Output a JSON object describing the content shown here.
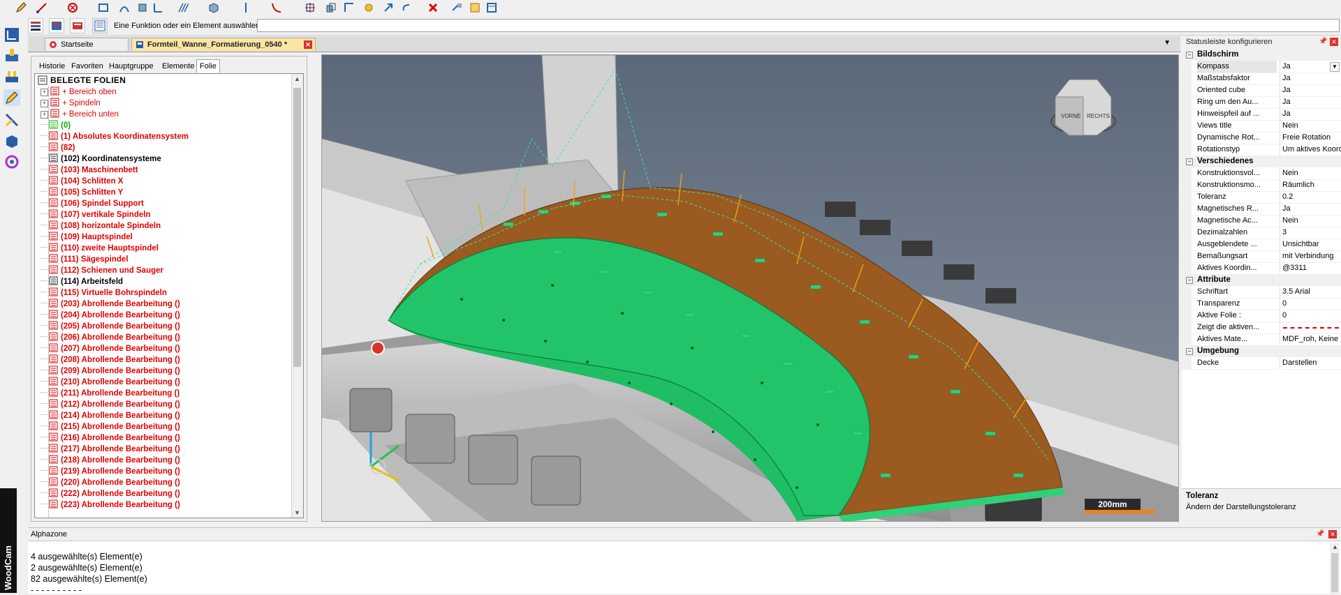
{
  "toolbar": {
    "command_label": "Eine Funktion oder ein Element auswählen:",
    "command_value": ""
  },
  "brand": "WoodCam",
  "doc_tabs": [
    {
      "label": "Startseite"
    },
    {
      "label": "Formteil_Wanne_Formatierung_0540 *"
    }
  ],
  "tree": {
    "tabs": [
      "Historie",
      "Favoriten",
      "Hauptgruppe",
      "Elemente",
      "Folie"
    ],
    "active_tab": "Folie",
    "header": "BELEGTE FOLIEN",
    "items": [
      {
        "label": "+ Bereich oben",
        "style": "red-light",
        "expandable": true
      },
      {
        "label": "+ Spindeln",
        "style": "red-light",
        "expandable": true
      },
      {
        "label": "+ Bereich unten",
        "style": "red-light",
        "expandable": true
      },
      {
        "label": "(0)",
        "style": "green",
        "expandable": false
      },
      {
        "label": "(1) Absolutes Koordinatensystem",
        "style": "red",
        "expandable": false
      },
      {
        "label": "(82)",
        "style": "red",
        "expandable": false
      },
      {
        "label": "(102) Koordinatensysteme",
        "style": "black",
        "expandable": false
      },
      {
        "label": "(103) Maschinenbett",
        "style": "red",
        "expandable": false
      },
      {
        "label": "(104) Schlitten X",
        "style": "red",
        "expandable": false
      },
      {
        "label": "(105) Schlitten Y",
        "style": "red",
        "expandable": false
      },
      {
        "label": "(106) Spindel Support",
        "style": "red",
        "expandable": false
      },
      {
        "label": "(107) vertikale Spindeln",
        "style": "red",
        "expandable": false
      },
      {
        "label": "(108) horizontale Spindeln",
        "style": "red",
        "expandable": false
      },
      {
        "label": "(109) Hauptspindel",
        "style": "red",
        "expandable": false
      },
      {
        "label": "(110) zweite Hauptspindel",
        "style": "red",
        "expandable": false
      },
      {
        "label": "(111) Sägespindel",
        "style": "red",
        "expandable": false
      },
      {
        "label": "(112) Schienen und Sauger",
        "style": "red",
        "expandable": false
      },
      {
        "label": "(114) Arbeitsfeld",
        "style": "black",
        "expandable": false
      },
      {
        "label": "(115) Virtuelle Bohrspindeln",
        "style": "red",
        "expandable": false
      },
      {
        "label": "(203) Abrollende Bearbeitung ()",
        "style": "red",
        "expandable": false
      },
      {
        "label": "(204) Abrollende Bearbeitung ()",
        "style": "red",
        "expandable": false
      },
      {
        "label": "(205) Abrollende Bearbeitung ()",
        "style": "red",
        "expandable": false
      },
      {
        "label": "(206) Abrollende Bearbeitung ()",
        "style": "red",
        "expandable": false
      },
      {
        "label": "(207) Abrollende Bearbeitung ()",
        "style": "red",
        "expandable": false
      },
      {
        "label": "(208) Abrollende Bearbeitung ()",
        "style": "red",
        "expandable": false
      },
      {
        "label": "(209) Abrollende Bearbeitung ()",
        "style": "red",
        "expandable": false
      },
      {
        "label": "(210) Abrollende Bearbeitung ()",
        "style": "red",
        "expandable": false
      },
      {
        "label": "(211) Abrollende Bearbeitung ()",
        "style": "red",
        "expandable": false
      },
      {
        "label": "(212) Abrollende Bearbeitung ()",
        "style": "red",
        "expandable": false
      },
      {
        "label": "(214) Abrollende Bearbeitung ()",
        "style": "red",
        "expandable": false
      },
      {
        "label": "(215) Abrollende Bearbeitung ()",
        "style": "red",
        "expandable": false
      },
      {
        "label": "(216) Abrollende Bearbeitung ()",
        "style": "red",
        "expandable": false
      },
      {
        "label": "(217) Abrollende Bearbeitung ()",
        "style": "red",
        "expandable": false
      },
      {
        "label": "(218) Abrollende Bearbeitung ()",
        "style": "red",
        "expandable": false
      },
      {
        "label": "(219) Abrollende Bearbeitung ()",
        "style": "red",
        "expandable": false
      },
      {
        "label": "(220) Abrollende Bearbeitung ()",
        "style": "red",
        "expandable": false
      },
      {
        "label": "(222) Abrollende Bearbeitung ()",
        "style": "red",
        "expandable": false
      },
      {
        "label": "(223) Abrollende Bearbeitung ()",
        "style": "red",
        "expandable": false
      }
    ]
  },
  "viewport": {
    "cube_labels": [
      "VORNE",
      "RECHTS"
    ],
    "scale_label": "200mm"
  },
  "properties": {
    "title": "Statusleiste konfigurieren",
    "categories": [
      {
        "name": "Bildschirm",
        "rows": [
          {
            "key": "Kompass",
            "value": "Ja",
            "selected": true
          },
          {
            "key": "Maßstabsfaktor",
            "value": "Ja"
          },
          {
            "key": "Oriented cube",
            "value": "Ja"
          },
          {
            "key": "Ring um den Au...",
            "value": "Ja"
          },
          {
            "key": "Hinweispfeil auf ...",
            "value": "Ja"
          },
          {
            "key": "Views title",
            "value": "Nein"
          },
          {
            "key": "Dynamische Rot...",
            "value": "Freie Rotation"
          },
          {
            "key": "Rotationstyp",
            "value": "Um aktives Koordin..."
          }
        ]
      },
      {
        "name": "Verschiedenes",
        "rows": [
          {
            "key": "Konstruktionsvol...",
            "value": "Nein"
          },
          {
            "key": "Konstruktionsmo...",
            "value": "Räumlich"
          },
          {
            "key": "Toleranz",
            "value": "0.2"
          },
          {
            "key": "Magnetisches R...",
            "value": "Ja"
          },
          {
            "key": "Magnetische Ac...",
            "value": "Nein"
          },
          {
            "key": "Dezimalzahlen",
            "value": "3"
          },
          {
            "key": "Ausgeblendete ...",
            "value": "Unsichtbar"
          },
          {
            "key": "Bemaßungsart",
            "value": "mit Verbindung"
          },
          {
            "key": "Aktives Koordin...",
            "value": "@3311"
          }
        ]
      },
      {
        "name": "Attribute",
        "rows": [
          {
            "key": "Schriftart",
            "value": "3.5  Arial"
          },
          {
            "key": "Transparenz",
            "value": "0"
          },
          {
            "key": "Aktive Folie :",
            "value": "0"
          },
          {
            "key": "Zeigt die aktiven...",
            "value": ""
          },
          {
            "key": "Aktives Mate...",
            "value": "MDF_roh, Keine Be..."
          }
        ]
      },
      {
        "name": "Umgebung",
        "rows": [
          {
            "key": "Decke",
            "value": "Darstellen"
          }
        ]
      }
    ],
    "help_title": "Toleranz",
    "help_desc": "Ändern der Darstellungstoleranz"
  },
  "alphazone": {
    "title": "Alphazone",
    "lines": [
      "4 ausgewählte(s) Element(e)",
      "2 ausgewählte(s) Element(e)",
      "82 ausgewählte(s) Element(e)",
      "- - - - - - - - - -"
    ]
  },
  "colors": {
    "part_top": "#9a5a20",
    "part_face": "#22c46a",
    "viewport_bg": "#5d6b7d",
    "tab_active": "#fbe5a4",
    "tree_red": "#e00000"
  }
}
